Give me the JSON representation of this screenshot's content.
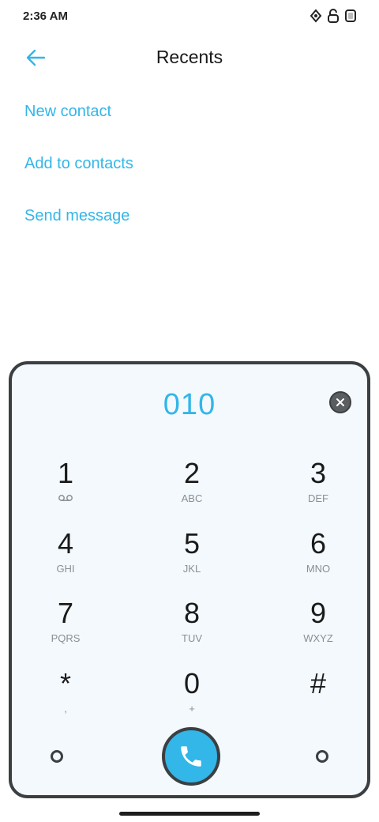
{
  "status_bar": {
    "time": "2:36 AM"
  },
  "header": {
    "title": "Recents",
    "back_icon": "back-arrow-icon"
  },
  "actions": [
    {
      "label": "New contact"
    },
    {
      "label": "Add to contacts"
    },
    {
      "label": "Send message"
    }
  ],
  "dialpad": {
    "number": "010",
    "keys": [
      {
        "digit": "1",
        "letters": ""
      },
      {
        "digit": "2",
        "letters": "ABC"
      },
      {
        "digit": "3",
        "letters": "DEF"
      },
      {
        "digit": "4",
        "letters": "GHI"
      },
      {
        "digit": "5",
        "letters": "JKL"
      },
      {
        "digit": "6",
        "letters": "MNO"
      },
      {
        "digit": "7",
        "letters": "PQRS"
      },
      {
        "digit": "8",
        "letters": "TUV"
      },
      {
        "digit": "9",
        "letters": "WXYZ"
      },
      {
        "digit": "*",
        "letters": ","
      },
      {
        "digit": "0",
        "letters": "+"
      },
      {
        "digit": "#",
        "letters": ""
      }
    ]
  },
  "colors": {
    "accent": "#33b6e8",
    "outline": "#3c3f41",
    "pad_bg": "#f3f9fd"
  }
}
